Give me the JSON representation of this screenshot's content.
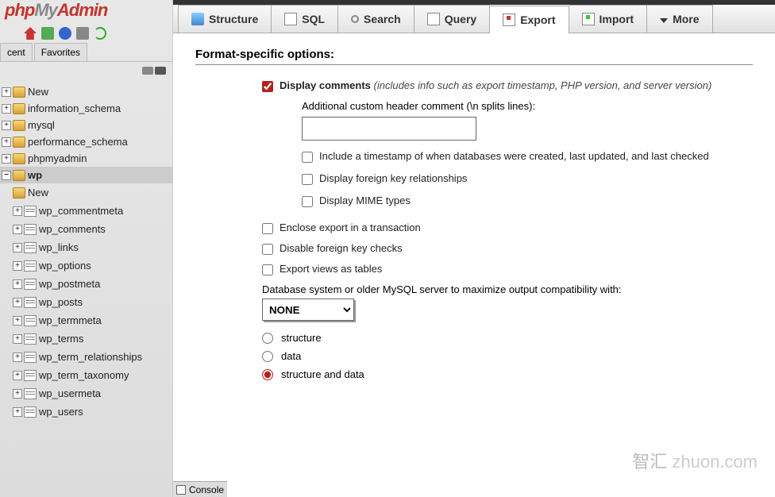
{
  "logo": {
    "part1": "php",
    "part2": "My",
    "part3": "Admin"
  },
  "sidebar": {
    "tabs": [
      "cent",
      "Favorites"
    ],
    "databases": [
      {
        "label": "New",
        "icon": "db"
      },
      {
        "label": "information_schema",
        "icon": "db"
      },
      {
        "label": "mysql",
        "icon": "db"
      },
      {
        "label": "performance_schema",
        "icon": "db"
      },
      {
        "label": "phpmyadmin",
        "icon": "db"
      }
    ],
    "selected_db": "wp",
    "tables": [
      "New",
      "wp_commentmeta",
      "wp_comments",
      "wp_links",
      "wp_options",
      "wp_postmeta",
      "wp_posts",
      "wp_termmeta",
      "wp_terms",
      "wp_term_relationships",
      "wp_term_taxonomy",
      "wp_usermeta",
      "wp_users"
    ]
  },
  "main_tabs": [
    {
      "label": "Structure",
      "icon": "structure"
    },
    {
      "label": "SQL",
      "icon": "sql"
    },
    {
      "label": "Search",
      "icon": "search"
    },
    {
      "label": "Query",
      "icon": "query"
    },
    {
      "label": "Export",
      "icon": "export"
    },
    {
      "label": "Import",
      "icon": "import"
    },
    {
      "label": "More",
      "icon": "more"
    }
  ],
  "active_tab": 4,
  "section_title": "Format-specific options:",
  "options": {
    "display_comments": {
      "label": "Display comments",
      "hint": "(includes info such as export timestamp, PHP version, and server version)",
      "checked": true
    },
    "custom_header": {
      "label": "Additional custom header comment (\\n splits lines):",
      "value": ""
    },
    "include_timestamp": {
      "label": "Include a timestamp of when databases were created, last updated, and last checked",
      "checked": false
    },
    "display_fk": {
      "label": "Display foreign key relationships",
      "checked": false
    },
    "display_mime": {
      "label": "Display MIME types",
      "checked": false
    },
    "enclose_transaction": {
      "label": "Enclose export in a transaction",
      "checked": false
    },
    "disable_fk": {
      "label": "Disable foreign key checks",
      "checked": false
    },
    "export_views": {
      "label": "Export views as tables",
      "checked": false
    },
    "compat": {
      "label": "Database system or older MySQL server to maximize output compatibility with:",
      "value": "NONE"
    },
    "dump_radio": {
      "options": [
        "structure",
        "data",
        "structure and data"
      ],
      "selected": 2
    }
  },
  "console_label": "Console",
  "watermark": {
    "cn": "智汇",
    "en": "zhuon.com"
  }
}
